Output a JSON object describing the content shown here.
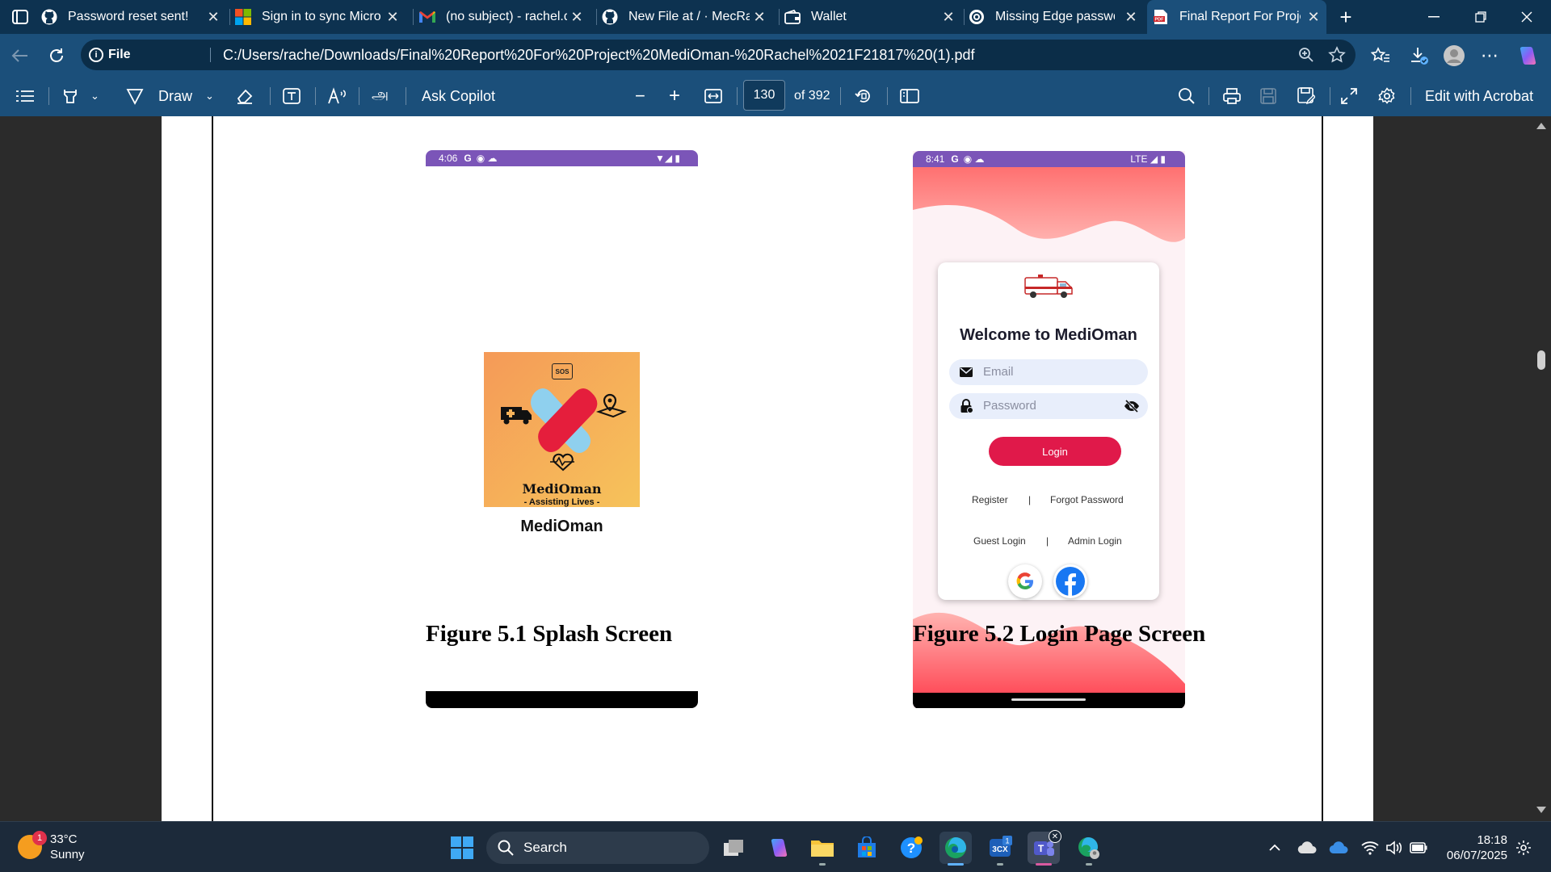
{
  "browser": {
    "tabs": [
      {
        "title": "Password reset sent! · G",
        "icon": "github-icon"
      },
      {
        "title": "Sign in to sync Microso",
        "icon": "microsoft-icon"
      },
      {
        "title": "(no subject) - rachel.ds",
        "icon": "gmail-icon"
      },
      {
        "title": "New File at / · MecRach",
        "icon": "github-icon"
      },
      {
        "title": "Wallet",
        "icon": "wallet-icon"
      },
      {
        "title": "Missing Edge passwo",
        "icon": "edge-icon"
      },
      {
        "title": "Final Report For Projec",
        "icon": "pdf-icon",
        "active": true
      }
    ],
    "address": {
      "scheme_label": "File",
      "url": "C:/Users/rache/Downloads/Final%20Report%20For%20Project%20MediOman-%20Rachel%2021F21817%20(1).pdf"
    }
  },
  "pdf_toolbar": {
    "draw_label": "Draw",
    "copilot_label": "Ask Copilot",
    "page_current": "130",
    "page_total": "of 392",
    "acrobat_label": "Edit with Acrobat"
  },
  "document": {
    "figure1": {
      "status_time": "4:06",
      "logo_title": "MediOman",
      "logo_subtitle": "- Assisting Lives -",
      "logo_badge": "SOS",
      "app_name": "MediOman",
      "caption": "Figure 5.1 Splash Screen"
    },
    "figure2": {
      "status_time": "8:41",
      "status_network": "LTE",
      "welcome": "Welcome to MediOman",
      "email_placeholder": "Email",
      "password_placeholder": "Password",
      "login_label": "Login",
      "register_label": "Register",
      "forgot_label": "Forgot Password",
      "guest_label": "Guest Login",
      "admin_label": "Admin Login",
      "divider": "|",
      "caption": "Figure 5.2 Login Page Screen"
    }
  },
  "taskbar": {
    "weather_temp": "33°C",
    "weather_desc": "Sunny",
    "weather_badge": "1",
    "search_label": "Search",
    "clock_time": "18:18",
    "clock_date": "06/07/2025",
    "teams_badge": "1"
  },
  "colors": {
    "titlebar": "#0d3250",
    "toolbar": "#1b4f7a",
    "status_purple": "#7b55b8",
    "login_red": "#e0194a"
  }
}
